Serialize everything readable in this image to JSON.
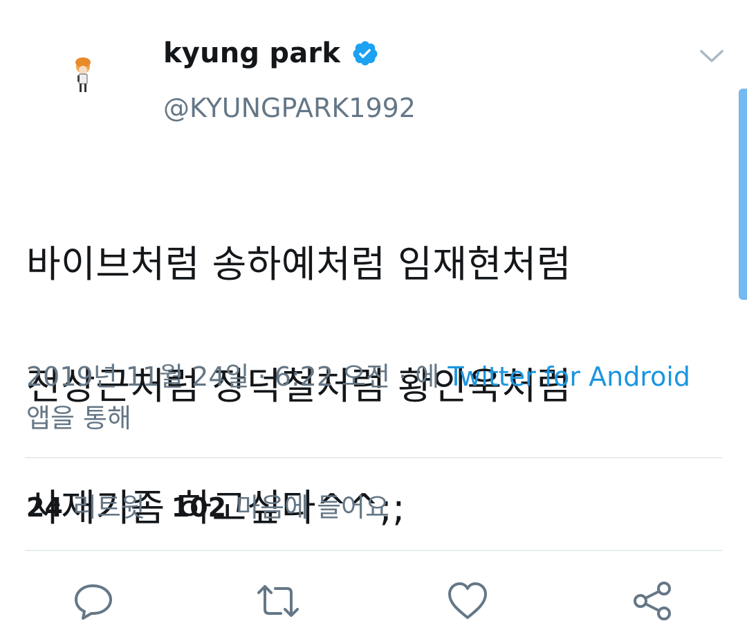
{
  "tweet": {
    "author": {
      "display_name": "kyung park",
      "handle": "@KYUNGPARK1992",
      "verified": true
    },
    "text_lines": [
      "바이브처럼 송하예처럼 임재현처럼",
      "전상근처럼 장덕철처럼 황인욱처럼",
      "사재기좀 하고싶다^^;;"
    ],
    "meta": {
      "date": "2019년 11월 24일",
      "separator": " · ",
      "time": "6:22 오전",
      "via_prefix": "에 ",
      "source": "Twitter for Android",
      "via_suffix": " 앱을 통해"
    },
    "stats": {
      "retweets_count": "24",
      "retweets_label": "리트윗",
      "likes_count": "102",
      "likes_label": "마음에 들어요"
    }
  },
  "icons": {
    "verified": "verified-badge-icon",
    "menu": "chevron-down-icon",
    "reply": "reply-icon",
    "retweet": "retweet-icon",
    "like": "heart-icon",
    "share": "share-icon"
  },
  "colors": {
    "text_primary": "#14171a",
    "text_secondary": "#657786",
    "link": "#1b95e0",
    "verified": "#1da1f2",
    "divider": "#e6ecf0"
  }
}
